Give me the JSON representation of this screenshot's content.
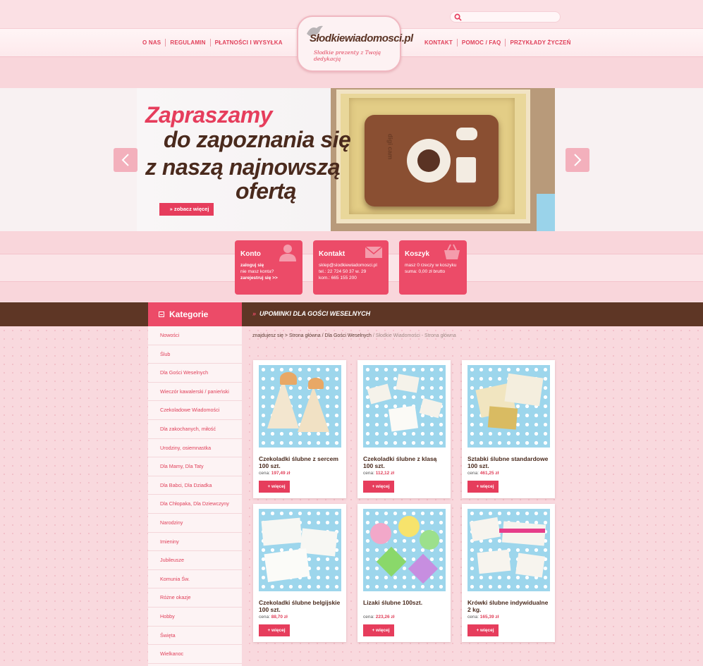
{
  "header": {
    "nav_left": [
      "O NAS",
      "REGULAMIN",
      "PŁATNOŚCI I WYSYŁKA"
    ],
    "nav_right": [
      "KONTAKT",
      "POMOC / FAQ",
      "PRZYKŁADY ŻYCZEŃ"
    ],
    "search_placeholder": ""
  },
  "logo": {
    "name": "Słodkiewiadomosci.pl",
    "tagline": "Słodkie prezenty z Twoją dedykacją"
  },
  "hero": {
    "line1": "Zapraszamy",
    "line2": "do zapoznania się",
    "line3": "z naszą najnowszą",
    "line4": "ofertą",
    "button": "»  zobacz więcej",
    "camera_label": "digi cam"
  },
  "info": {
    "konto": {
      "title": "Konto",
      "login": "zaloguj się",
      "no_account": "nie masz konta?",
      "register": "zarejestruj się >>"
    },
    "kontakt": {
      "title": "Kontakt",
      "email": "sklep@slodkiewiadomosci.pl",
      "tel": "tel.: 22 724 50 37 w. 29",
      "kom": "kom.: 665 155 200"
    },
    "koszyk": {
      "title": "Koszyk",
      "items": "masz 0 rzeczy w koszyku",
      "sum": "suma: 0,00 zł brutto"
    }
  },
  "categories": {
    "title": "Kategorie",
    "items": [
      "Nowości",
      "Ślub",
      "Dla Gości Weselnych",
      "Wieczór kawalerski / panieński",
      "Czekoladowe Wiadomości",
      "Dla zakochanych, miłość",
      "Urodziny, osiemnastka",
      "Dla Mamy, Dla Taty",
      "Dla Babci, Dla Dziadka",
      "Dla Chłopaka, Dla Dziewczyny",
      "Narodziny",
      "Imieniny",
      "Jubileusze",
      "Komunia Św.",
      "Różne okazje",
      "Hobby",
      "Święta",
      "Wielkanoc"
    ]
  },
  "section": {
    "title": "UPOMINKI DLA GOŚCI WESELNYCH",
    "crumb_prefix": "znajdujesz się > ",
    "crumb_path": "Strona główna / Dla Gości Weselnych",
    "crumb_sep": " / ",
    "crumb_last": "Słodkie Wiadomości - Strona główna"
  },
  "products": [
    {
      "name": "Czekoladki ślubne z sercem 100 szt.",
      "price_label": "cena: ",
      "price": "197,49 zł",
      "button": "+  więcej"
    },
    {
      "name": "Czekoladki ślubne z klasą 100 szt.",
      "price_label": "cena: ",
      "price": "112,12 zł",
      "button": "+  więcej"
    },
    {
      "name": "Sztabki ślubne standardowe 100 szt.",
      "price_label": "cena: ",
      "price": "461,25 zł",
      "button": "+  więcej"
    },
    {
      "name": "Czekoladki ślubne belgijskie 100 szt.",
      "price_label": "cena: ",
      "price": "88,70 zł",
      "button": "+  więcej"
    },
    {
      "name": "Lizaki ślubne 100szt.",
      "price_label": "cena: ",
      "price": "223,26 zł",
      "button": "+  więcej"
    },
    {
      "name": "Krówki ślubne indywidualne 2 kg.",
      "price_label": "cena: ",
      "price": "165,39 zł",
      "button": "+  więcej"
    }
  ],
  "colors": {
    "accent": "#e63d5c",
    "brown": "#5e3625",
    "pink_bg": "#f9d6db"
  }
}
